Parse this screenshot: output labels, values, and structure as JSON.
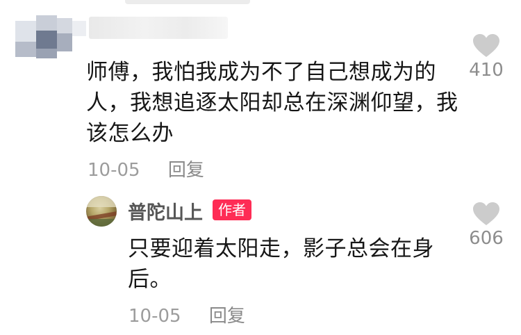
{
  "comment": {
    "text": "师傅，我怕我成为不了自己想成为的人，我想追逐太阳却总在深渊仰望，我该怎么办",
    "date": "10-05",
    "reply_label": "回复",
    "like_count": "410"
  },
  "reply": {
    "author": "普陀山上",
    "badge": "作者",
    "text": "只要迎着太阳走，影子总会在身后。",
    "date": "10-05",
    "reply_label": "回复",
    "like_count": "606"
  },
  "colors": {
    "badge": "#fe2c55",
    "heart": "#cccccc",
    "meta": "#9c9c9c"
  },
  "icons": [
    "heart-icon",
    "avatar"
  ]
}
